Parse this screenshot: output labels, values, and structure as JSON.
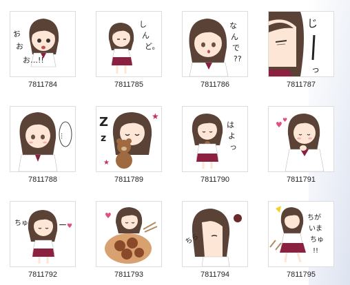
{
  "stickers": [
    {
      "id": "7811784",
      "text": "おおお…!!"
    },
    {
      "id": "7811785",
      "text": "しんど。"
    },
    {
      "id": "7811786",
      "text": "なんで??"
    },
    {
      "id": "7811787",
      "text": "じーっ"
    },
    {
      "id": "7811788",
      "text": "…"
    },
    {
      "id": "7811789",
      "text": "Zz"
    },
    {
      "id": "7811790",
      "text": "はよっ"
    },
    {
      "id": "7811791",
      "text": ""
    },
    {
      "id": "7811792",
      "text": "ちゅー"
    },
    {
      "id": "7811793",
      "text": ""
    },
    {
      "id": "7811794",
      "text": "ちら"
    },
    {
      "id": "7811795",
      "text": "ちがいまちゅ!!"
    }
  ]
}
